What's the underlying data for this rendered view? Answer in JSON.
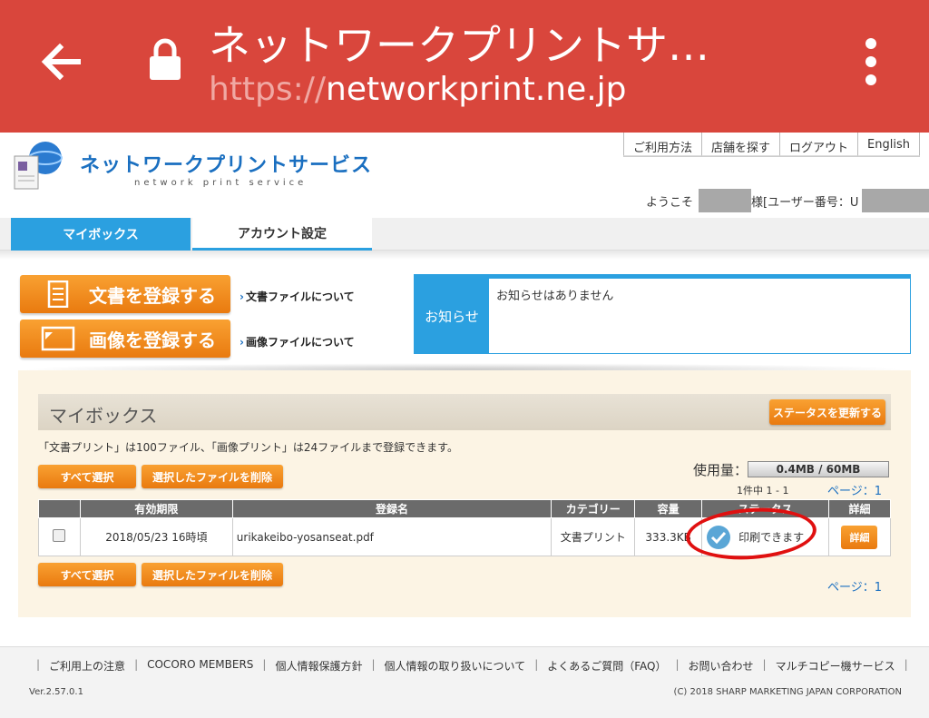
{
  "browser": {
    "title": "ネットワークプリントサ…",
    "url_scheme": "https://",
    "url_host": "networkprint.ne.jp"
  },
  "header": {
    "logo_text": "ネットワークプリントサービス",
    "logo_sub": "network print service",
    "links": [
      "ご利用方法",
      "店舗を探す",
      "ログアウト",
      "English"
    ],
    "welcome_prefix": "ようこそ",
    "welcome_middle": "様[ユーザー番号：U"
  },
  "tabs": [
    {
      "label": "マイボックス",
      "active": true
    },
    {
      "label": "アカウント設定",
      "active": false
    }
  ],
  "register": {
    "doc_button": "文書を登録する",
    "doc_link": "文書ファイルについて",
    "img_button": "画像を登録する",
    "img_link": "画像ファイルについて"
  },
  "notice": {
    "label": "お知らせ",
    "message": "お知らせはありません"
  },
  "mybox": {
    "title": "マイボックス",
    "refresh_button": "ステータスを更新する",
    "limit_note": "「文書プリント」は100ファイル、「画像プリント」は24ファイルまで登録できます。",
    "select_all": "すべて選択",
    "delete_selected": "選択したファイルを削除",
    "usage_label": "使用量：",
    "usage_value": "0.4MB / 60MB",
    "count": "1件中 1 - 1",
    "page_label": "ページ：",
    "page_number": "1",
    "columns": [
      "",
      "有効期限",
      "登録名",
      "カテゴリー",
      "容量",
      "ステータス",
      "詳細"
    ],
    "rows": [
      {
        "expiry": "2018/05/23 16時頃",
        "name": "urikakeibo-yosanseat.pdf",
        "category": "文書プリント",
        "size": "333.3KB",
        "status": "印刷できます",
        "detail": "詳細"
      }
    ]
  },
  "footer": {
    "links": [
      "ご利用上の注意",
      "COCORO MEMBERS",
      "個人情報保護方針",
      "個人情報の取り扱いについて",
      "よくあるご質問（FAQ）",
      "お問い合わせ",
      "マルチコピー機サービス"
    ],
    "version": "Ver.2.57.0.1",
    "copyright": "(C) 2018 SHARP MARKETING JAPAN CORPORATION"
  },
  "colors": {
    "chrome": "#d9463c",
    "accent_blue": "#2ba0e0",
    "orange": "#f08a1c",
    "highlight_ring": "#e01010"
  }
}
